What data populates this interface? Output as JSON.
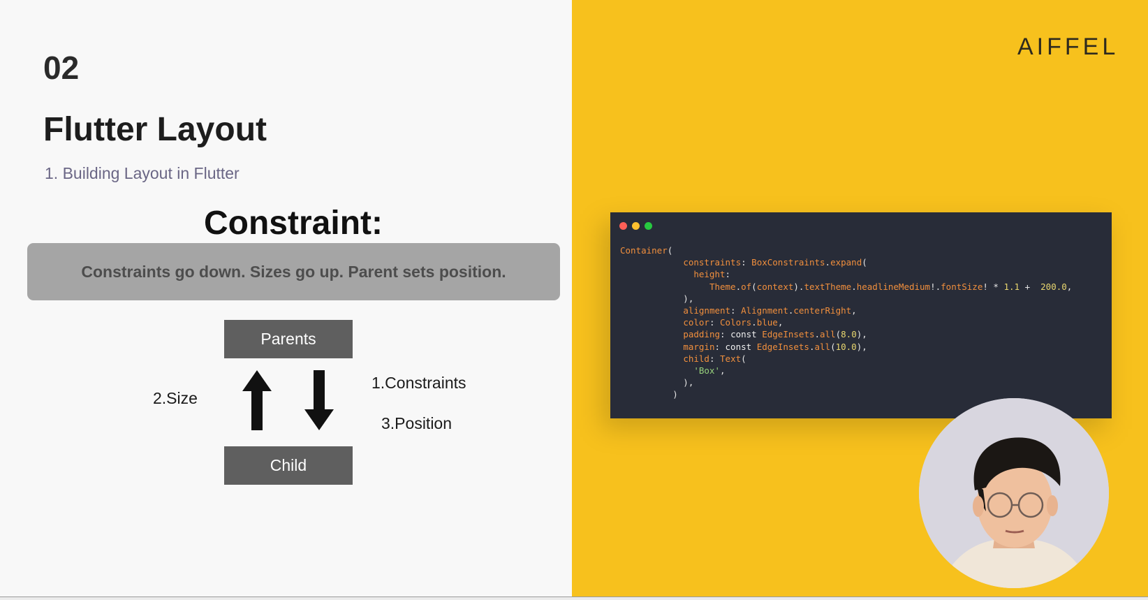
{
  "slide": {
    "section_number": "02",
    "title": "Flutter Layout",
    "subtitle": "1. Building Layout in Flutter",
    "constraint_heading": "Constraint:",
    "rule_text": "Constraints go down. Sizes go up. Parent sets position."
  },
  "diagram": {
    "parent_label": "Parents",
    "child_label": "Child",
    "size_label": "2.Size",
    "constraints_label": "1.Constraints",
    "position_label": "3.Position",
    "box_color": "#5f5f5f",
    "arrow_color": "#111111"
  },
  "brand": {
    "logo_text": "AIFFEL"
  },
  "code_window": {
    "controls": [
      "close",
      "minimize",
      "maximize"
    ],
    "control_colors": {
      "close": "#fe5f57",
      "minimize": "#fec02f",
      "maximize": "#27c840"
    },
    "lines": [
      [
        {
          "t": "Container",
          "c": "tok-type"
        },
        {
          "t": "(",
          "c": "tok-plain"
        }
      ],
      [
        {
          "t": "            ",
          "c": "tok-plain"
        },
        {
          "t": "constraints",
          "c": "tok-prop"
        },
        {
          "t": ": ",
          "c": "tok-plain"
        },
        {
          "t": "BoxConstraints",
          "c": "tok-type"
        },
        {
          "t": ".",
          "c": "tok-plain"
        },
        {
          "t": "expand",
          "c": "tok-method"
        },
        {
          "t": "(",
          "c": "tok-plain"
        }
      ],
      [
        {
          "t": "              ",
          "c": "tok-plain"
        },
        {
          "t": "height",
          "c": "tok-prop"
        },
        {
          "t": ":",
          "c": "tok-plain"
        }
      ],
      [
        {
          "t": "                 ",
          "c": "tok-plain"
        },
        {
          "t": "Theme",
          "c": "tok-type"
        },
        {
          "t": ".",
          "c": "tok-plain"
        },
        {
          "t": "of",
          "c": "tok-method"
        },
        {
          "t": "(",
          "c": "tok-plain"
        },
        {
          "t": "context",
          "c": "tok-prop"
        },
        {
          "t": ").",
          "c": "tok-plain"
        },
        {
          "t": "textTheme",
          "c": "tok-prop"
        },
        {
          "t": ".",
          "c": "tok-plain"
        },
        {
          "t": "headlineMedium",
          "c": "tok-prop"
        },
        {
          "t": "!.",
          "c": "tok-plain"
        },
        {
          "t": "fontSize",
          "c": "tok-prop"
        },
        {
          "t": "! * ",
          "c": "tok-plain"
        },
        {
          "t": "1.1",
          "c": "tok-num"
        },
        {
          "t": " +  ",
          "c": "tok-plain"
        },
        {
          "t": "200.0",
          "c": "tok-num"
        },
        {
          "t": ",",
          "c": "tok-plain"
        }
      ],
      [
        {
          "t": "            ),",
          "c": "tok-plain"
        }
      ],
      [
        {
          "t": "            ",
          "c": "tok-plain"
        },
        {
          "t": "alignment",
          "c": "tok-prop"
        },
        {
          "t": ": ",
          "c": "tok-plain"
        },
        {
          "t": "Alignment",
          "c": "tok-type"
        },
        {
          "t": ".",
          "c": "tok-plain"
        },
        {
          "t": "centerRight",
          "c": "tok-prop"
        },
        {
          "t": ",",
          "c": "tok-plain"
        }
      ],
      [
        {
          "t": "            ",
          "c": "tok-plain"
        },
        {
          "t": "color",
          "c": "tok-prop"
        },
        {
          "t": ": ",
          "c": "tok-plain"
        },
        {
          "t": "Colors",
          "c": "tok-type"
        },
        {
          "t": ".",
          "c": "tok-plain"
        },
        {
          "t": "blue",
          "c": "tok-prop"
        },
        {
          "t": ",",
          "c": "tok-plain"
        }
      ],
      [
        {
          "t": "            ",
          "c": "tok-plain"
        },
        {
          "t": "padding",
          "c": "tok-prop"
        },
        {
          "t": ": ",
          "c": "tok-plain"
        },
        {
          "t": "const",
          "c": "tok-keyword"
        },
        {
          "t": " ",
          "c": "tok-plain"
        },
        {
          "t": "EdgeInsets",
          "c": "tok-type"
        },
        {
          "t": ".",
          "c": "tok-plain"
        },
        {
          "t": "all",
          "c": "tok-method"
        },
        {
          "t": "(",
          "c": "tok-plain"
        },
        {
          "t": "8.0",
          "c": "tok-num"
        },
        {
          "t": "),",
          "c": "tok-plain"
        }
      ],
      [
        {
          "t": "            ",
          "c": "tok-plain"
        },
        {
          "t": "margin",
          "c": "tok-prop"
        },
        {
          "t": ": ",
          "c": "tok-plain"
        },
        {
          "t": "const",
          "c": "tok-keyword"
        },
        {
          "t": " ",
          "c": "tok-plain"
        },
        {
          "t": "EdgeInsets",
          "c": "tok-type"
        },
        {
          "t": ".",
          "c": "tok-plain"
        },
        {
          "t": "all",
          "c": "tok-method"
        },
        {
          "t": "(",
          "c": "tok-plain"
        },
        {
          "t": "10.0",
          "c": "tok-num"
        },
        {
          "t": "),",
          "c": "tok-plain"
        }
      ],
      [
        {
          "t": "            ",
          "c": "tok-plain"
        },
        {
          "t": "child",
          "c": "tok-prop"
        },
        {
          "t": ": ",
          "c": "tok-plain"
        },
        {
          "t": "Text",
          "c": "tok-type"
        },
        {
          "t": "(",
          "c": "tok-plain"
        }
      ],
      [
        {
          "t": "              ",
          "c": "tok-plain"
        },
        {
          "t": "'Box'",
          "c": "tok-string"
        },
        {
          "t": ",",
          "c": "tok-plain"
        }
      ],
      [
        {
          "t": "            ),",
          "c": "tok-plain"
        }
      ],
      [
        {
          "t": "          )",
          "c": "tok-plain"
        }
      ]
    ]
  },
  "presenter": {
    "icon": "presenter-webcam"
  },
  "colors": {
    "left_background": "#f8f8f8",
    "right_background": "#f7c11d",
    "banner_background": "#a5a5a5",
    "code_background": "#282c38",
    "subtitle": "#6a6685"
  }
}
